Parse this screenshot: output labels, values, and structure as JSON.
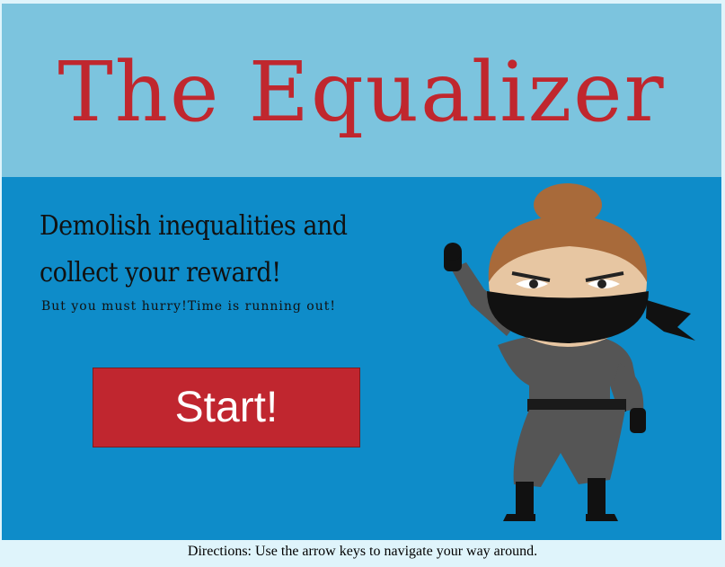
{
  "game": {
    "title": "The Equalizer",
    "headline_line1": "Demolish inequalities and",
    "headline_line2": "collect your reward!",
    "subtitle": "But you must hurry!Time is running out!",
    "start_label": "Start!",
    "directions": "Directions: Use the arrow keys to navigate your way around.",
    "character": "ninja-girl"
  },
  "colors": {
    "header_bg": "#7cc4de",
    "body_bg": "#0e8cc9",
    "title": "#c0272e",
    "button": "#c0262f",
    "footer_bg": "#dff4fb"
  }
}
